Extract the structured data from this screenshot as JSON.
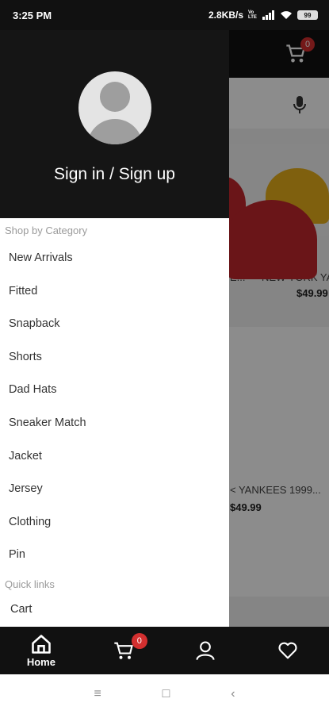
{
  "status_bar": {
    "time": "3:25 PM",
    "network_speed": "2.8KB/s",
    "volte": "Vo LTE",
    "battery": "99"
  },
  "header": {
    "cart_count": "0"
  },
  "products": [
    {
      "name": "E...",
      "price": ""
    },
    {
      "name": "NEW YORK YA",
      "price": "$49.99"
    },
    {
      "name": "< YANKEES 1999...",
      "price": "$49.99"
    }
  ],
  "drawer": {
    "sign_in_label": "Sign in / Sign up",
    "category_heading": "Shop by Category",
    "categories": [
      "New Arrivals",
      "Fitted",
      "Snapback",
      "Shorts",
      "Dad Hats",
      "Sneaker Match",
      "Jacket",
      "Jersey",
      "Clothing",
      "Pin"
    ],
    "quick_links_heading": "Quick links",
    "quick_links": [
      "Cart"
    ]
  },
  "bottom_nav": {
    "home_label": "Home",
    "cart_count": "0"
  },
  "colors": {
    "badge": "#d32f2f",
    "header_bg": "#151515",
    "nav_bg": "#111111"
  }
}
